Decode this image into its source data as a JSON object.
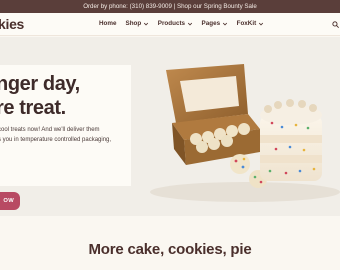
{
  "announcement": "Order by phone: (310) 839-9009 | Shop our Spring Bounty Sale",
  "header": {
    "logo": "kies",
    "nav": [
      {
        "label": "Home"
      },
      {
        "label": "Shop"
      },
      {
        "label": "Products"
      },
      {
        "label": "Pages"
      },
      {
        "label": "FoxKit"
      }
    ],
    "icons": [
      "search-icon"
    ]
  },
  "hero": {
    "title_lines": [
      "nger day,",
      "re treat."
    ],
    "description_lines": [
      "cool treats now! And we'll deliver them",
      "s you in temperature controlled packaging,"
    ],
    "button_label": "OW"
  },
  "section": {
    "title": "More cake, cookies, pie"
  },
  "colors": {
    "topbar": "#5a3e3a",
    "accent": "#b84a63",
    "text": "#3e2b2a",
    "hero_bg": "#f1eee8"
  }
}
